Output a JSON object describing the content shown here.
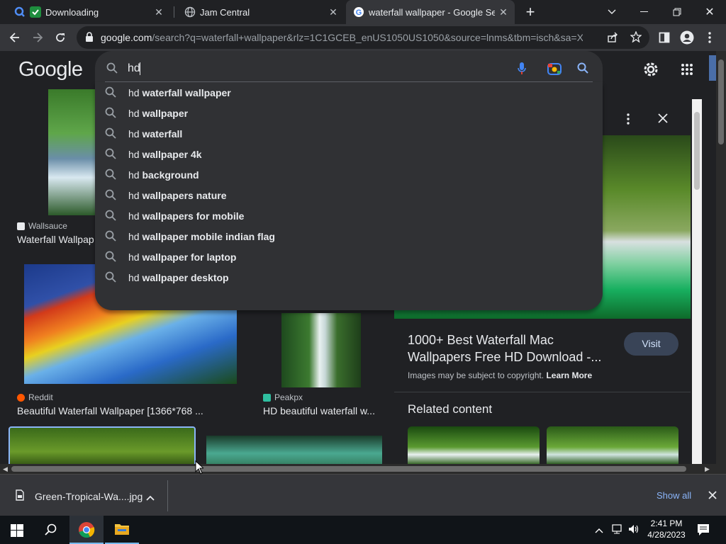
{
  "tabs": [
    {
      "title": "Downloading",
      "favicon": "chrome-download-check-icon"
    },
    {
      "title": "Jam Central",
      "favicon": "globe-icon"
    },
    {
      "title": "waterfall wallpaper - Google Sea",
      "favicon": "google-g-icon"
    }
  ],
  "toolbar": {
    "url_main": "google.com",
    "url_rest": "/search?q=waterfall+wallpaper&rlz=1C1GCEB_enUS1050US1050&source=lnms&tbm=isch&sa=X&v..."
  },
  "google": {
    "logo": "Google",
    "query": "hd",
    "suggestions": [
      {
        "prefix": "hd",
        "rest": "waterfall wallpaper"
      },
      {
        "prefix": "hd",
        "rest": "wallpaper"
      },
      {
        "prefix": "hd",
        "rest": "waterfall"
      },
      {
        "prefix": "hd",
        "rest": "wallpaper 4k"
      },
      {
        "prefix": "hd",
        "rest": "background"
      },
      {
        "prefix": "hd",
        "rest": "wallpapers nature"
      },
      {
        "prefix": "hd",
        "rest": "wallpapers for mobile"
      },
      {
        "prefix": "hd",
        "rest": "wallpaper mobile indian flag"
      },
      {
        "prefix": "hd",
        "rest": "wallpaper for laptop"
      },
      {
        "prefix": "hd",
        "rest": "wallpaper desktop"
      }
    ]
  },
  "results": [
    {
      "source": "Wallsauce",
      "title": "Waterfall Wallpap",
      "source_color": "#e8eaed"
    },
    {
      "source": "Reddit",
      "title": "Beautiful Waterfall Wallpaper [1366*768 ...",
      "source_color": "#ff5700"
    },
    {
      "source": "Peakpx",
      "title": "HD beautiful waterfall w...",
      "source_color": "#2fbfa0"
    }
  ],
  "panel": {
    "title": "1000+ Best Waterfall Mac Wallpapers Free HD Download -...",
    "visit_label": "Visit",
    "copyright_text": "Images may be subject to copyright.",
    "learn_more": "Learn More",
    "related_heading": "Related content"
  },
  "download": {
    "filename": "Green-Tropical-Wa....jpg",
    "show_all": "Show all"
  },
  "taskbar": {
    "time": "2:41 PM",
    "date": "4/28/2023"
  }
}
